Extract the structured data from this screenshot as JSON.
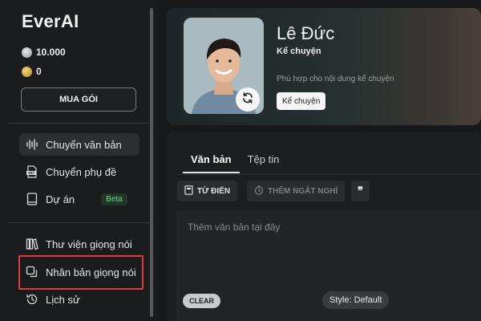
{
  "app": {
    "logo": "EverAI"
  },
  "credits": {
    "balance_silver": "10.000",
    "balance_gold": "0"
  },
  "sidebar": {
    "buy_label": "MUA GÓI",
    "items": [
      {
        "label": "Chuyển văn bản",
        "icon": "waveform-icon",
        "active": true
      },
      {
        "label": "Chuyển phụ đề",
        "icon": "srt-file-icon"
      },
      {
        "label": "Dự án",
        "icon": "book-icon",
        "badge": "Beta"
      },
      {
        "label": "Thư viện giọng nói",
        "icon": "library-icon"
      },
      {
        "label": "Nhân bản giọng nói",
        "icon": "clone-icon"
      },
      {
        "label": "Lịch sử",
        "icon": "history-icon"
      }
    ]
  },
  "voice": {
    "name": "Lê Đức",
    "style": "Kể chuyện",
    "description": "Phù hợp cho nội dung kể chuyện",
    "tag": "Kể chuyện"
  },
  "editor": {
    "tabs": [
      {
        "label": "Văn bản"
      },
      {
        "label": "Tệp tin"
      }
    ],
    "toolbar": {
      "dictionary_label": "TỪ ĐIỂN",
      "pause_label": "THÊM NGẮT NGHỈ",
      "quote_label": "❞"
    },
    "placeholder": "Thêm văn bản tại đây",
    "clear_label": "CLEAR",
    "style_label": "Style: Default"
  },
  "colors": {
    "highlight": "#e23b3b",
    "beta": "#7ad58f"
  }
}
